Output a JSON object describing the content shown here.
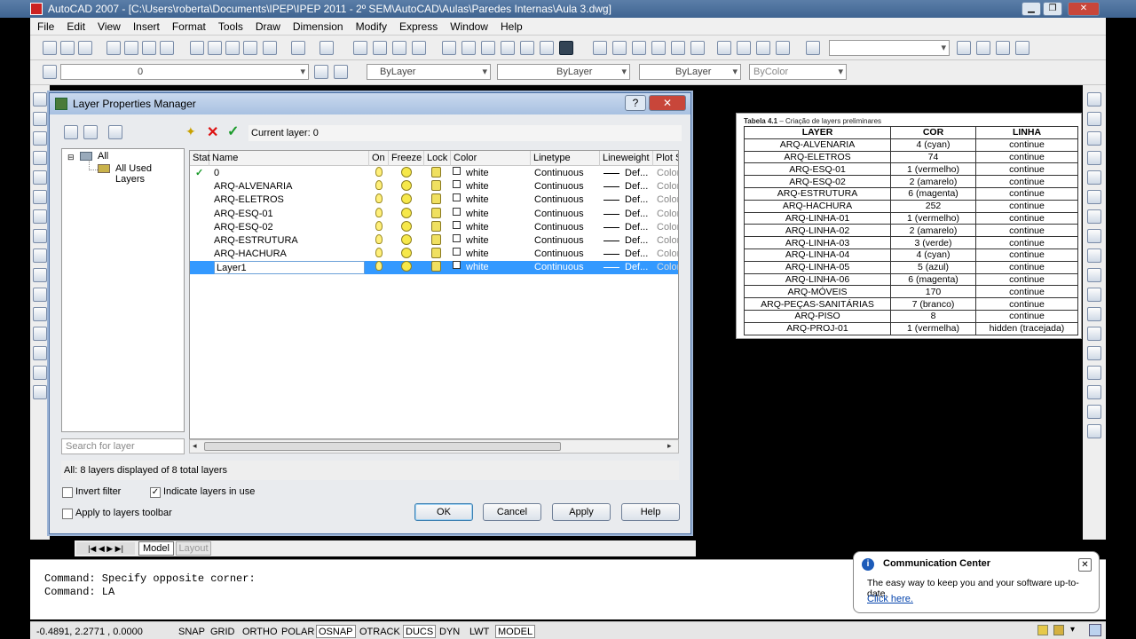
{
  "window": {
    "title": "AutoCAD 2007 - [C:\\Users\\roberta\\Documents\\IPEP\\IPEP 2011 - 2º SEM\\AutoCAD\\Aulas\\Paredes Internas\\Aula 3.dwg]"
  },
  "menu": [
    "File",
    "Edit",
    "View",
    "Insert",
    "Format",
    "Tools",
    "Draw",
    "Dimension",
    "Modify",
    "Express",
    "Window",
    "Help"
  ],
  "props_toolbar": {
    "layer_combo": "0",
    "color_combo": "ByLayer",
    "linetype_combo": "ByLayer",
    "lineweight_combo": "ByLayer",
    "plotstyle_combo": "ByColor"
  },
  "dialog": {
    "title": "Layer Properties Manager",
    "current_layer": "Current layer: 0",
    "tree": {
      "root": "All",
      "child": "All Used Layers"
    },
    "search_placeholder": "Search for layer",
    "columns": [
      "Stat",
      "Name",
      "On",
      "Freeze",
      "Lock",
      "Color",
      "Linetype",
      "Lineweight",
      "Plot S"
    ],
    "layers": [
      {
        "status": "✓",
        "name": "0",
        "color": "white",
        "linetype": "Continuous",
        "lineweight": "Def...",
        "plot": "Color_"
      },
      {
        "status": "",
        "name": "ARQ-ALVENARIA",
        "color": "white",
        "linetype": "Continuous",
        "lineweight": "Def...",
        "plot": "Color_"
      },
      {
        "status": "",
        "name": "ARQ-ELETROS",
        "color": "white",
        "linetype": "Continuous",
        "lineweight": "Def...",
        "plot": "Color_"
      },
      {
        "status": "",
        "name": "ARQ-ESQ-01",
        "color": "white",
        "linetype": "Continuous",
        "lineweight": "Def...",
        "plot": "Color_"
      },
      {
        "status": "",
        "name": "ARQ-ESQ-02",
        "color": "white",
        "linetype": "Continuous",
        "lineweight": "Def...",
        "plot": "Color_"
      },
      {
        "status": "",
        "name": "ARQ-ESTRUTURA",
        "color": "white",
        "linetype": "Continuous",
        "lineweight": "Def...",
        "plot": "Color_"
      },
      {
        "status": "",
        "name": "ARQ-HACHURA",
        "color": "white",
        "linetype": "Continuous",
        "lineweight": "Def...",
        "plot": "Color_"
      },
      {
        "status": "",
        "name": "Layer1",
        "color": "white",
        "linetype": "Continuous",
        "lineweight": "Def...",
        "plot": "Color_",
        "selected": true
      }
    ],
    "summary": "All: 8 layers displayed of 8 total layers",
    "invert_filter": "Invert filter",
    "indicate_layers": "Indicate layers in use",
    "apply_to_toolbar": "Apply to layers toolbar",
    "buttons": {
      "ok": "OK",
      "cancel": "Cancel",
      "apply": "Apply",
      "help": "Help"
    }
  },
  "reference_table": {
    "caption_bold": "Tabela 4.1",
    "caption_text": " – Criação de layers preliminares",
    "headers": [
      "LAYER",
      "COR",
      "LINHA"
    ],
    "rows": [
      [
        "ARQ-ALVENARIA",
        "4 (cyan)",
        "continue"
      ],
      [
        "ARQ-ELETROS",
        "74",
        "continue"
      ],
      [
        "ARQ-ESQ-01",
        "1 (vermelho)",
        "continue"
      ],
      [
        "ARQ-ESQ-02",
        "2 (amarelo)",
        "continue"
      ],
      [
        "ARQ-ESTRUTURA",
        "6 (magenta)",
        "continue"
      ],
      [
        "ARQ-HACHURA",
        "252",
        "continue"
      ],
      [
        "ARQ-LINHA-01",
        "1 (vermelho)",
        "continue"
      ],
      [
        "ARQ-LINHA-02",
        "2 (amarelo)",
        "continue"
      ],
      [
        "ARQ-LINHA-03",
        "3 (verde)",
        "continue"
      ],
      [
        "ARQ-LINHA-04",
        "4 (cyan)",
        "continue"
      ],
      [
        "ARQ-LINHA-05",
        "5 (azul)",
        "continue"
      ],
      [
        "ARQ-LINHA-06",
        "6 (magenta)",
        "continue"
      ],
      [
        "ARQ-MÓVEIS",
        "170",
        "continue"
      ],
      [
        "ARQ-PEÇAS-SANITÁRIAS",
        "7 (branco)",
        "continue"
      ],
      [
        "ARQ-PISO",
        "8",
        "continue"
      ],
      [
        "ARQ-PROJ-01",
        "1 (vermelha)",
        "hidden (tracejada)"
      ]
    ]
  },
  "layout_tabs": {
    "model": "Model",
    "layout": "Layout"
  },
  "command": {
    "line1": "Command: Specify opposite corner:",
    "line2": "Command: LA"
  },
  "status": {
    "coords": "-0.4891, 2.2771 , 0.0000",
    "buttons": [
      "SNAP",
      "GRID",
      "ORTHO",
      "POLAR",
      "OSNAP",
      "OTRACK",
      "DUCS",
      "DYN",
      "LWT",
      "MODEL"
    ],
    "active": [
      "OSNAP",
      "DUCS",
      "MODEL"
    ]
  },
  "communication_center": {
    "title": "Communication Center",
    "body": "The easy way to keep you and your software up-to-date.",
    "link": "Click here."
  },
  "colors": {
    "selection": "#3399ff",
    "titlebar": "#4a6fa0",
    "canvas": "#000000"
  }
}
